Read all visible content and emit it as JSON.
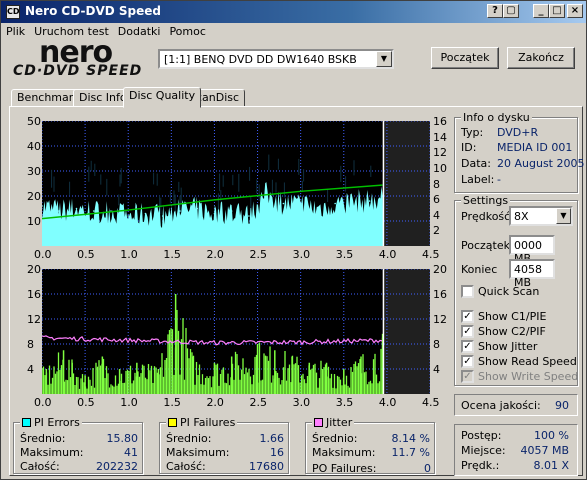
{
  "window": {
    "title": "Nero CD-DVD Speed",
    "icon_label": "CD"
  },
  "menu": [
    "Plik",
    "Uruchom test",
    "Dodatki",
    "Pomoc"
  ],
  "logo": {
    "brand": "nero",
    "product": "CD·DVD SPEED"
  },
  "drive": {
    "selected": "[1:1]  BENQ DVD DD DW1640 BSKB"
  },
  "buttons": {
    "start": "Początek",
    "exit": "Zakończ"
  },
  "tabs": [
    {
      "label": "Benchmark",
      "active": false
    },
    {
      "label": "Disc Info",
      "active": false
    },
    {
      "label": "Disc Quality",
      "active": true
    },
    {
      "label": "ScanDisc",
      "active": false
    }
  ],
  "disc_info": {
    "title": "Info o dysku",
    "rows": [
      {
        "label": "Typ:",
        "value": "DVD+R"
      },
      {
        "label": "ID:",
        "value": "MEDIA ID 001"
      },
      {
        "label": "Data:",
        "value": "20 August 2005"
      },
      {
        "label": "Label:",
        "value": "-"
      }
    ]
  },
  "settings": {
    "title": "Settings",
    "speed_label": "Prędkość",
    "speed_value": "8X",
    "start_label": "Początek",
    "start_value": "0000 MB",
    "end_label": "Koniec",
    "end_value": "4058 MB",
    "checks": [
      {
        "label": "Quick Scan",
        "checked": false,
        "disabled": false
      },
      {
        "label": "Show C1/PIE",
        "checked": true,
        "disabled": false
      },
      {
        "label": "Show C2/PIF",
        "checked": true,
        "disabled": false
      },
      {
        "label": "Show Jitter",
        "checked": true,
        "disabled": false
      },
      {
        "label": "Show Read Speed",
        "checked": true,
        "disabled": false
      },
      {
        "label": "Show Write Speed",
        "checked": true,
        "disabled": true
      }
    ]
  },
  "quality": {
    "label": "Ocena jakości:",
    "value": "90"
  },
  "progress": {
    "rows": [
      {
        "label": "Postęp:",
        "value": "100 %"
      },
      {
        "label": "Miejsce:",
        "value": "4057 MB"
      },
      {
        "label": "Prędk.:",
        "value": "8.01 X"
      }
    ]
  },
  "pi_errors": {
    "title": "PI Errors",
    "color": "#00ffff",
    "rows": [
      {
        "label": "Średnio:",
        "value": "15.80"
      },
      {
        "label": "Maksimum:",
        "value": "41"
      },
      {
        "label": "Całość:",
        "value": "202232"
      }
    ]
  },
  "pi_failures": {
    "title": "PI Failures",
    "color": "#ffff00",
    "rows": [
      {
        "label": "Średnio:",
        "value": "1.66"
      },
      {
        "label": "Maksimum:",
        "value": "16"
      },
      {
        "label": "Całość:",
        "value": "17680"
      }
    ]
  },
  "jitter": {
    "title": "Jitter",
    "color": "#ff80ff",
    "rows": [
      {
        "label": "Średnio:",
        "value": "8.14 %"
      },
      {
        "label": "Maksimum:",
        "value": "11.7 %"
      }
    ],
    "po_label": "PO Failures:",
    "po_value": "0"
  },
  "chart_data": [
    {
      "type": "area",
      "title": "",
      "xlabel": "",
      "ylabel": "",
      "xlim": [
        0,
        4.5
      ],
      "ylim": [
        0,
        50
      ],
      "y2lim": [
        0,
        16
      ],
      "x_ticks": [
        "0.0",
        "0.5",
        "1.0",
        "1.5",
        "2.0",
        "2.5",
        "3.0",
        "3.5",
        "4.0",
        "4.5"
      ],
      "y_ticks": [
        "10",
        "20",
        "30",
        "40",
        "50"
      ],
      "y2_ticks": [
        "2",
        "4",
        "6",
        "8",
        "10",
        "12",
        "14",
        "16"
      ],
      "grid": true,
      "colors": {
        "bg": "#000000",
        "fill": "#80ffff",
        "peaks": "#000000",
        "speed": "#00c000",
        "end_marker": "#ffffff",
        "grid": "#4060ff"
      },
      "series": [
        {
          "name": "PI Errors",
          "x": [
            0.0,
            0.2,
            0.4,
            0.6,
            0.8,
            1.0,
            1.2,
            1.4,
            1.6,
            1.8,
            2.0,
            2.2,
            2.4,
            2.6,
            2.8,
            3.0,
            3.2,
            3.4,
            3.6,
            3.8,
            3.95
          ],
          "values": [
            16,
            14,
            15,
            14,
            14,
            12,
            13,
            12,
            14,
            15,
            13,
            14,
            12,
            21,
            17,
            17,
            15,
            17,
            18,
            18,
            20
          ]
        },
        {
          "name": "Read Speed",
          "x": [
            0.0,
            1.0,
            2.0,
            3.0,
            3.95
          ],
          "values": [
            3.5,
            4.6,
            5.9,
            7.0,
            7.8
          ]
        }
      ],
      "end_x": 3.96
    },
    {
      "type": "bar",
      "title": "",
      "xlabel": "",
      "ylabel": "",
      "xlim": [
        0,
        4.5
      ],
      "ylim": [
        0,
        20
      ],
      "y2lim": [
        0,
        20
      ],
      "x_ticks": [
        "0.0",
        "0.5",
        "1.0",
        "1.5",
        "2.0",
        "2.5",
        "3.0",
        "3.5",
        "4.0",
        "4.5"
      ],
      "y_ticks": [
        "4",
        "8",
        "12",
        "16",
        "20"
      ],
      "y2_ticks": [
        "4",
        "8",
        "12",
        "16",
        "20"
      ],
      "grid": true,
      "colors": {
        "bg": "#000000",
        "bars": "#80ff40",
        "jitter": "#ff80ff",
        "end_marker": "#ffffff",
        "grid": "#4060ff"
      },
      "series": [
        {
          "name": "PI Failures",
          "x": [
            0.05,
            0.25,
            0.35,
            0.5,
            0.7,
            0.9,
            1.1,
            1.35,
            1.55,
            1.75,
            2.0,
            2.2,
            2.5,
            2.7,
            2.9,
            3.1,
            3.3,
            3.5,
            3.7,
            3.95
          ],
          "values": [
            4,
            7,
            5,
            3,
            6,
            4,
            5,
            4,
            16,
            6,
            5,
            6,
            8,
            7,
            6,
            5,
            5,
            4,
            6,
            9
          ]
        },
        {
          "name": "Jitter",
          "x": [
            0.0,
            1.0,
            2.0,
            3.0,
            3.95
          ],
          "values": [
            9.0,
            8.6,
            8.2,
            8.3,
            8.6
          ]
        }
      ],
      "end_x": 3.96
    }
  ]
}
